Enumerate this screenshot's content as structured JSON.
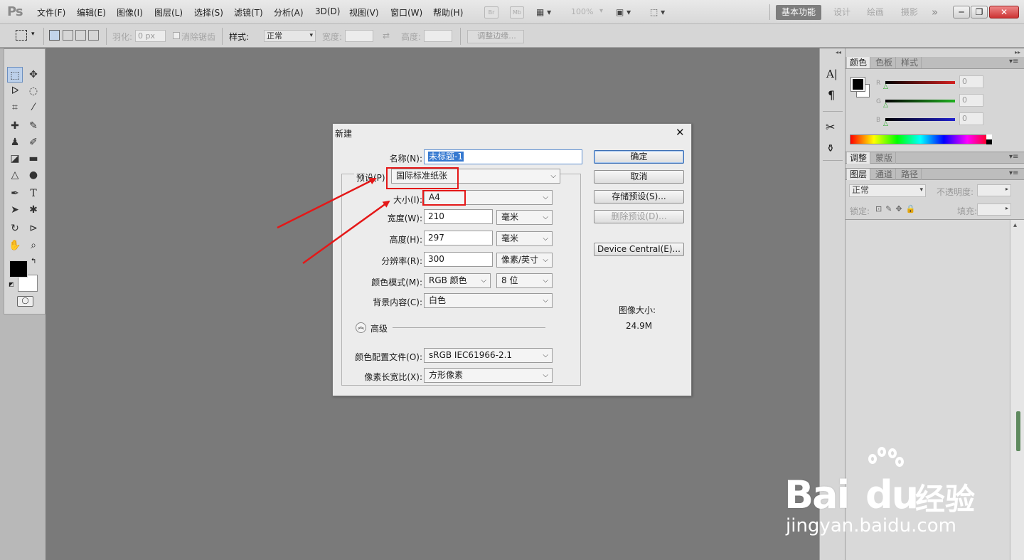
{
  "menubar": {
    "app_logo": "Ps",
    "menus": [
      "文件(F)",
      "编辑(E)",
      "图像(I)",
      "图层(L)",
      "选择(S)",
      "滤镜(T)",
      "分析(A)",
      "3D(D)",
      "视图(V)",
      "窗口(W)",
      "帮助(H)"
    ],
    "bridge_label": "Br",
    "minibridge_label": "Mb",
    "zoom": "100%",
    "workspaces": [
      "基本功能",
      "设计",
      "绘画",
      "摄影"
    ],
    "more": "»",
    "window_controls": {
      "minimize": "─",
      "restore": "❐",
      "close": "✕"
    }
  },
  "options_bar": {
    "feather_label": "羽化:",
    "feather_value": "0 px",
    "antialias_label": "消除锯齿",
    "style_label": "样式:",
    "style_value": "正常",
    "width_label": "宽度:",
    "height_label": "高度:",
    "refine_edge": "调整边缘..."
  },
  "right_panel": {
    "color_tabs": [
      "颜色",
      "色板",
      "样式"
    ],
    "channels": [
      {
        "label": "R",
        "value": "0",
        "color": "#d42020"
      },
      {
        "label": "G",
        "value": "0",
        "color": "#20b020"
      },
      {
        "label": "B",
        "value": "0",
        "color": "#2020d0"
      }
    ],
    "adjust_tabs": [
      "调整",
      "蒙版"
    ],
    "layer_tabs": [
      "图层",
      "通道",
      "路径"
    ],
    "blend_mode": "正常",
    "opacity_label": "不透明度:",
    "lock_label": "锁定:",
    "fill_label": "填充:"
  },
  "dialog": {
    "title": "新建",
    "name_label": "名称(N):",
    "name_value": "未标题-1",
    "preset_label": "预设(P):",
    "preset_value": "国际标准纸张",
    "size_label": "大小(I):",
    "size_value": "A4",
    "width_label": "宽度(W):",
    "width_value": "210",
    "width_unit": "毫米",
    "height_label": "高度(H):",
    "height_value": "297",
    "height_unit": "毫米",
    "resolution_label": "分辨率(R):",
    "resolution_value": "300",
    "resolution_unit": "像素/英寸",
    "color_mode_label": "颜色模式(M):",
    "color_mode_value": "RGB 颜色",
    "bit_depth": "8 位",
    "background_label": "背景内容(C):",
    "background_value": "白色",
    "advanced_label": "高级",
    "color_profile_label": "颜色配置文件(O):",
    "color_profile_value": "sRGB IEC61966-2.1",
    "pixel_aspect_label": "像素长宽比(X):",
    "pixel_aspect_value": "方形像素",
    "ok": "确定",
    "cancel": "取消",
    "save_preset": "存储预设(S)...",
    "delete_preset": "删除预设(D)...",
    "device_central": "Device Central(E)...",
    "image_size_label": "图像大小:",
    "image_size_value": "24.9M",
    "close": "✕"
  },
  "watermark": {
    "brand_a": "Bai",
    "brand_b": "du",
    "brand_c": "经验",
    "url": "jingyan.baidu.com"
  }
}
